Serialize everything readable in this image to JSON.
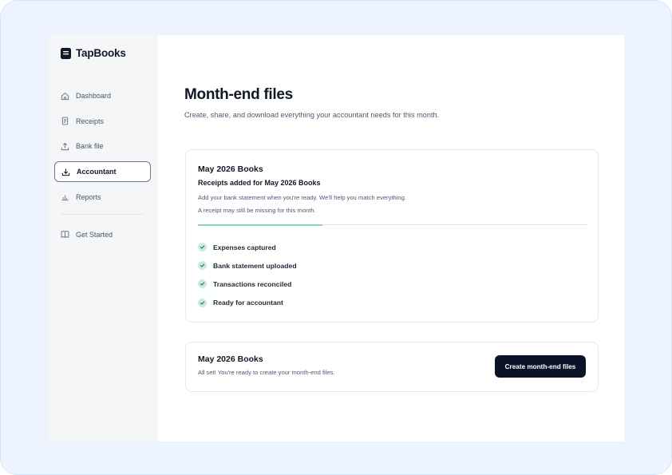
{
  "app": {
    "name": "TapBooks"
  },
  "sidebar": {
    "items": [
      {
        "label": "Dashboard",
        "icon": "home-icon",
        "active": false
      },
      {
        "label": "Receipts",
        "icon": "receipt-icon",
        "active": false
      },
      {
        "label": "Bank file",
        "icon": "upload-icon",
        "active": false
      },
      {
        "label": "Accountant",
        "icon": "download-icon",
        "active": true
      },
      {
        "label": "Reports",
        "icon": "bar-chart-icon",
        "active": false
      }
    ],
    "secondary": [
      {
        "label": "Get Started",
        "icon": "book-icon"
      }
    ]
  },
  "page": {
    "title": "Month-end files",
    "subtitle": "Create, share, and download everything your accountant needs for this month."
  },
  "progress_card": {
    "title": "May 2026 Books",
    "heading": "Receipts added for May 2026 Books",
    "note1": "Add your bank statement when you're ready. We'll help you match everything.",
    "note2": "A receipt may still be missing for this month.",
    "progress": 0.32,
    "checklist": [
      {
        "label": "Expenses captured",
        "done": true
      },
      {
        "label": "Bank statement uploaded",
        "done": true
      },
      {
        "label": "Transactions reconciled",
        "done": true
      },
      {
        "label": "Ready for accountant",
        "done": true
      }
    ]
  },
  "ready_card": {
    "title": "May 2026 Books",
    "text": "All set! You're ready to create your month-end files.",
    "button_label": "Create month-end files"
  },
  "colors": {
    "accent_dark": "#0b1426",
    "check_green": "#c9ecd9",
    "progress_green": "#8fd3b6",
    "page_background": "#eef4ff"
  }
}
